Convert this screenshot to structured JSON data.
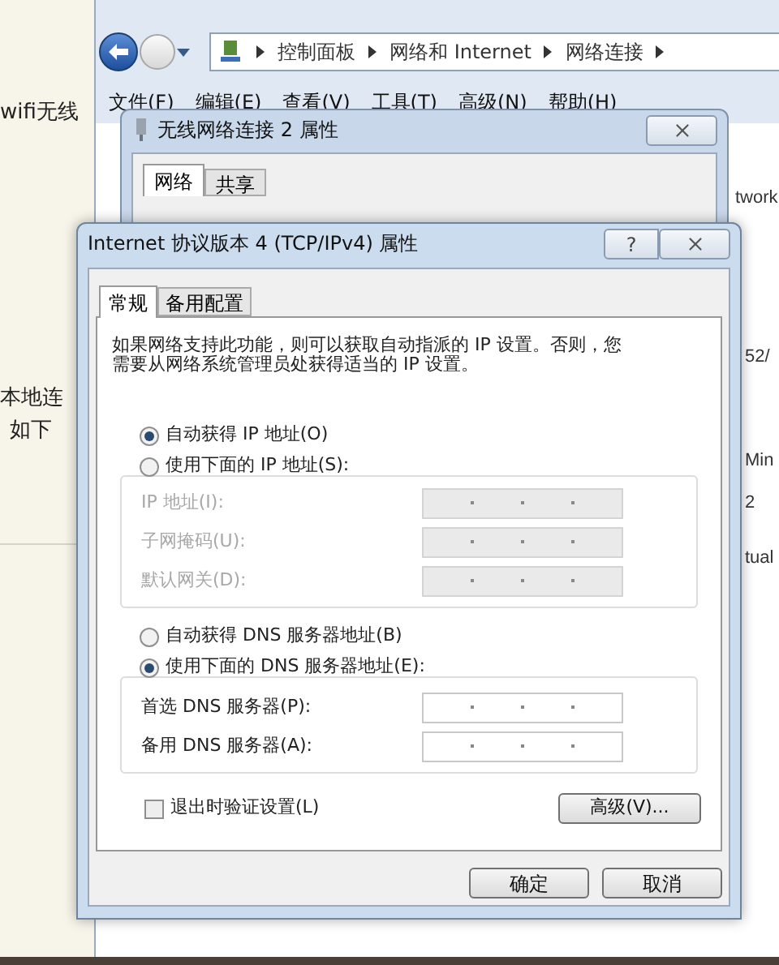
{
  "left_texts": [
    "wifi无线",
    "本地连",
    "如下"
  ],
  "right_texts": [
    "twork",
    "52/",
    "Min",
    "2",
    "tual"
  ],
  "explorer": {
    "breadcrumb": [
      "控制面板",
      "网络和 Internet",
      "网络连接"
    ],
    "menu": [
      "文件(F)",
      "编辑(E)",
      "查看(V)",
      "工具(T)",
      "高级(N)",
      "帮助(H)"
    ]
  },
  "adapter_dialog": {
    "title": "无线网络连接 2 属性",
    "tabs": [
      {
        "label": "网络",
        "selected": true
      },
      {
        "label": "共享",
        "selected": false
      }
    ]
  },
  "ipv4_dialog": {
    "title": "Internet 协议版本 4 (TCP/IPv4) 属性",
    "help": "?",
    "tabs": [
      {
        "label": "常规",
        "selected": true
      },
      {
        "label": "备用配置",
        "selected": false
      }
    ],
    "description": "如果网络支持此功能，则可以获取自动指派的 IP 设置。否则，您需要从网络系统管理员处获得适当的 IP 设置。",
    "ip_mode": [
      {
        "label": "自动获得 IP 地址(O)",
        "selected": true
      },
      {
        "label": "使用下面的 IP 地址(S):",
        "selected": false
      }
    ],
    "ip_fields": [
      {
        "label": "IP 地址(I):",
        "disabled": true
      },
      {
        "label": "子网掩码(U):",
        "disabled": true
      },
      {
        "label": "默认网关(D):",
        "disabled": true
      }
    ],
    "dns_mode": [
      {
        "label": "自动获得 DNS 服务器地址(B)",
        "selected": false
      },
      {
        "label": "使用下面的 DNS 服务器地址(E):",
        "selected": true
      }
    ],
    "dns_fields": [
      {
        "label": "首选 DNS 服务器(P):",
        "disabled": false
      },
      {
        "label": "备用 DNS 服务器(A):",
        "disabled": false
      }
    ],
    "validate": {
      "label": "退出时验证设置(L)",
      "checked": false
    },
    "advanced_button": "高级(V)...",
    "buttons": [
      "确定",
      "取消"
    ]
  }
}
